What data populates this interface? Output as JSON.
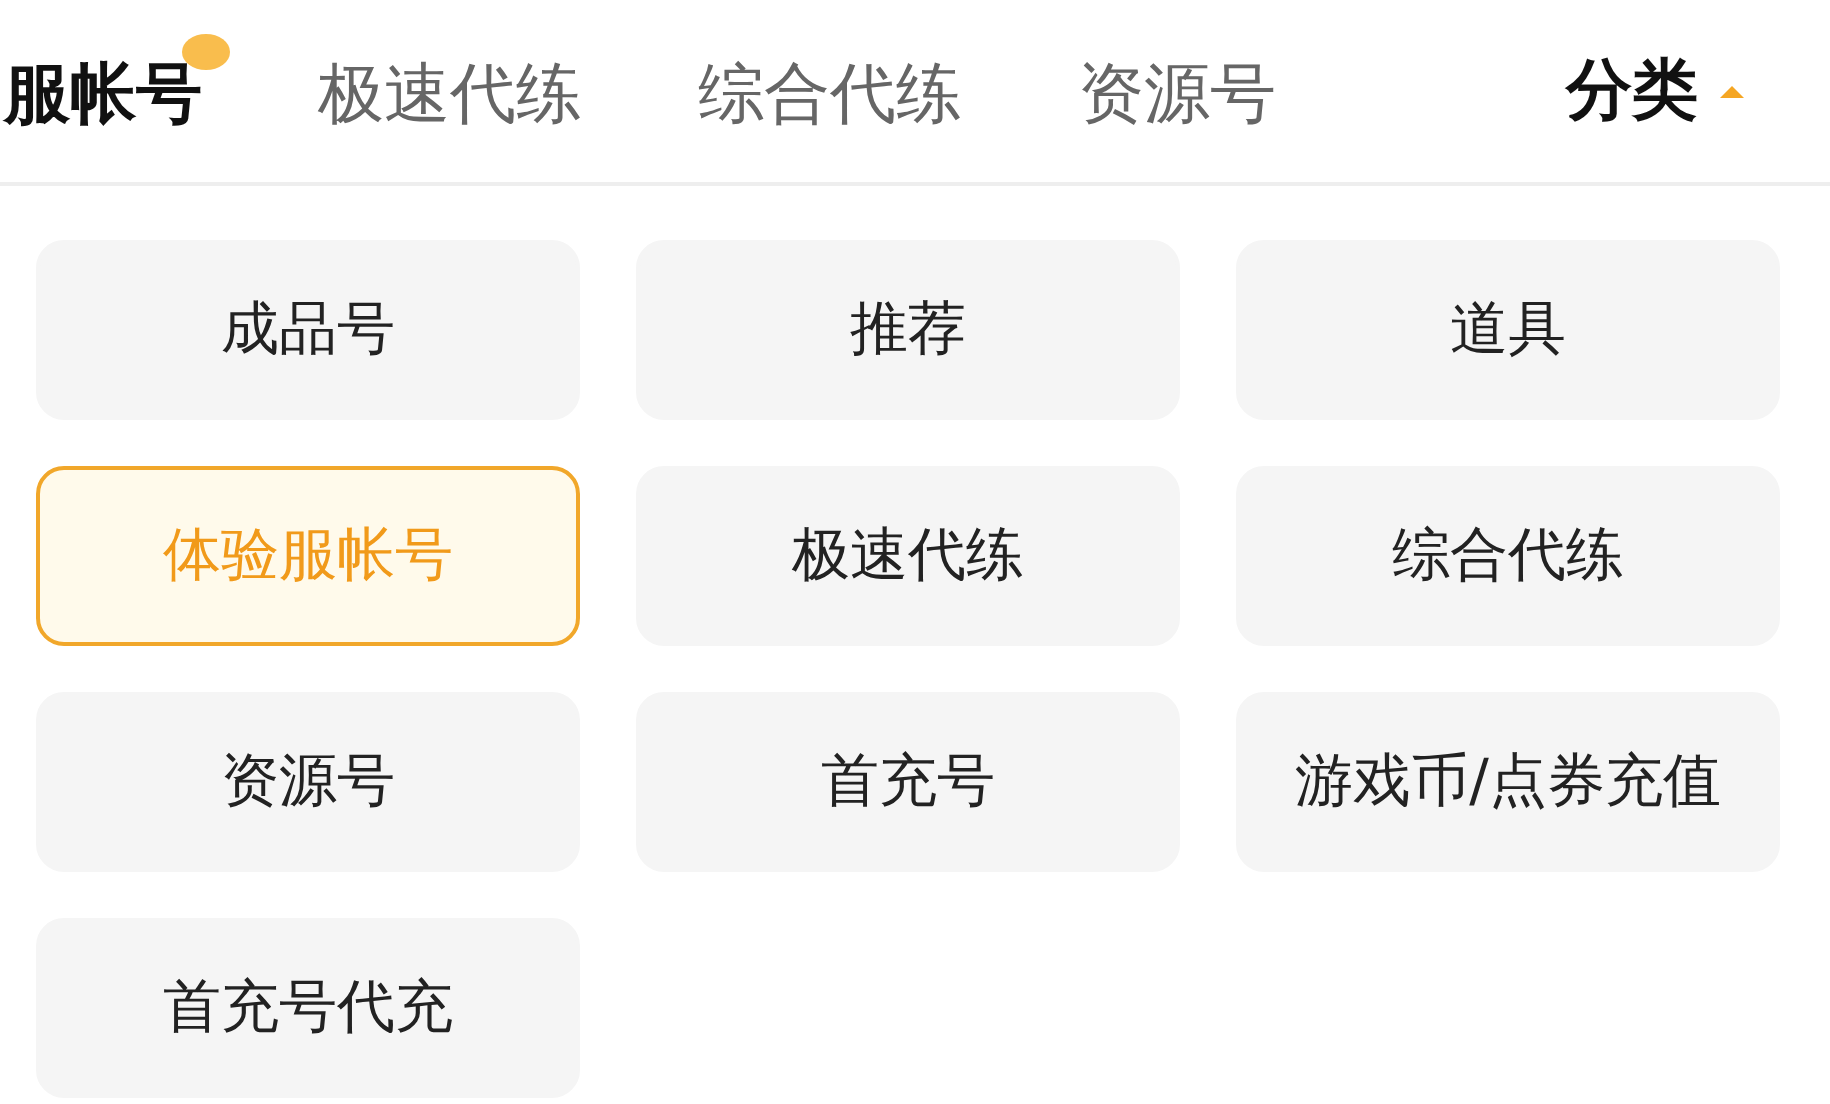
{
  "tabs": [
    {
      "label": "服帐号",
      "selected": true
    },
    {
      "label": "极速代练",
      "selected": false
    },
    {
      "label": "综合代练",
      "selected": false
    },
    {
      "label": "资源号",
      "selected": false
    }
  ],
  "category_button": {
    "label": "分类",
    "expanded": true
  },
  "categories": [
    {
      "label": "成品号",
      "selected": false
    },
    {
      "label": "推荐",
      "selected": false
    },
    {
      "label": "道具",
      "selected": false
    },
    {
      "label": "体验服帐号",
      "selected": true
    },
    {
      "label": "极速代练",
      "selected": false
    },
    {
      "label": "综合代练",
      "selected": false
    },
    {
      "label": "资源号",
      "selected": false
    },
    {
      "label": "首充号",
      "selected": false
    },
    {
      "label": "游戏币/点券充值",
      "selected": false
    },
    {
      "label": "首充号代充",
      "selected": false
    }
  ]
}
